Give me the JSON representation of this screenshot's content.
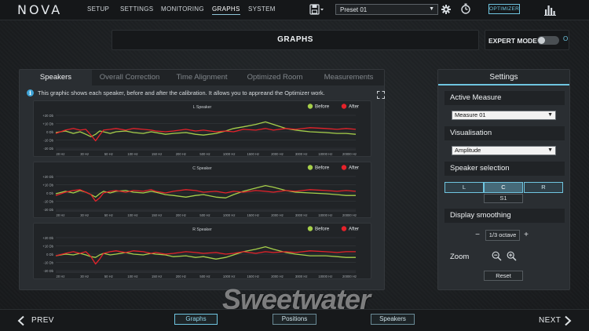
{
  "app": {
    "logo": "NOVA"
  },
  "nav": [
    {
      "label": "SETUP"
    },
    {
      "label": "SETTINGS"
    },
    {
      "label": "MONITORING"
    },
    {
      "label": "GRAPHS",
      "active": true
    },
    {
      "label": "SYSTEM"
    }
  ],
  "toolbar": {
    "save_icon": "save-icon",
    "preset": "Preset 01",
    "gear_icon": "gear-icon",
    "timer_icon": "stopwatch-icon",
    "optimizer_label": "OPTIMIZER",
    "bars_icon": "bar-graph-icon"
  },
  "header": {
    "title": "GRAPHS",
    "expert_label": "EXPERT MODE",
    "expert_on": false,
    "expert_state": "O"
  },
  "tabs": [
    {
      "label": "Speakers",
      "active": true
    },
    {
      "label": "Overall Correction"
    },
    {
      "label": "Time Alignment"
    },
    {
      "label": "Optimized Room"
    },
    {
      "label": "Measurements"
    }
  ],
  "info": {
    "icon": "i",
    "text": "This graphic shows each speaker, before and after the calibration. It allows you to appreand the Optimizer work."
  },
  "colors": {
    "before": "#a6cf4a",
    "after": "#e5222a",
    "accent": "#6fc5e0"
  },
  "chart_data": [
    {
      "type": "line",
      "title": "L Speaker",
      "legend": [
        "Before",
        "After"
      ],
      "legend_position": "top-right",
      "x_ticks": [
        "20 Hz",
        "30 Hz",
        "50 Hz",
        "100 Hz",
        "150 Hz",
        "200 Hz",
        "500 Hz",
        "1000 Hz",
        "1500 Hz",
        "2000 Hz",
        "3000 Hz",
        "10000 Hz",
        "20000 Hz"
      ],
      "y_ticks": [
        "+20 Db",
        "+10 Db",
        "0 Db",
        "-10 Db",
        "-20 Db"
      ],
      "ylim": [
        -20,
        20
      ],
      "x": [
        20,
        25,
        30,
        35,
        40,
        45,
        50,
        55,
        60,
        70,
        80,
        100,
        120,
        150,
        180,
        200,
        250,
        300,
        400,
        500,
        600,
        800,
        1000,
        1200,
        1500,
        2000,
        2500,
        3000,
        4000,
        5000,
        7000,
        10000,
        13000,
        16000,
        20000
      ],
      "series": [
        {
          "name": "Before",
          "values": [
            -1,
            1,
            -2,
            0,
            -3,
            -6,
            -3,
            1,
            0,
            -2,
            0,
            1,
            -1,
            -2,
            0,
            -1,
            -3,
            -2,
            -1,
            -3,
            -4,
            -2,
            1,
            4,
            6,
            9,
            12,
            9,
            4,
            2,
            0,
            -1,
            -2,
            -2,
            -3
          ]
        },
        {
          "name": "After",
          "values": [
            -2,
            2,
            4,
            2,
            3,
            -4,
            -11,
            -4,
            2,
            3,
            4,
            2,
            4,
            3,
            2,
            1,
            0,
            1,
            3,
            1,
            2,
            0,
            1,
            0,
            3,
            2,
            4,
            2,
            4,
            3,
            5,
            4,
            3,
            4,
            3
          ]
        }
      ]
    },
    {
      "type": "line",
      "title": "C Speaker",
      "legend": [
        "Before",
        "After"
      ],
      "legend_position": "top-right",
      "x_ticks": [
        "20 Hz",
        "30 Hz",
        "50 Hz",
        "100 Hz",
        "150 Hz",
        "200 Hz",
        "500 Hz",
        "1000 Hz",
        "1500 Hz",
        "2000 Hz",
        "3000 Hz",
        "10000 Hz",
        "20000 Hz"
      ],
      "y_ticks": [
        "+20 Db",
        "+10 Db",
        "0 Db",
        "-10 Db",
        "-20 Db"
      ],
      "ylim": [
        -20,
        20
      ],
      "x": [
        20,
        25,
        30,
        35,
        40,
        45,
        50,
        55,
        60,
        70,
        80,
        100,
        120,
        150,
        180,
        200,
        250,
        300,
        400,
        500,
        600,
        800,
        1000,
        1200,
        1500,
        2000,
        2500,
        3000,
        4000,
        5000,
        7000,
        10000,
        13000,
        16000,
        20000
      ],
      "series": [
        {
          "name": "Before",
          "values": [
            -1,
            2,
            0,
            3,
            1,
            -2,
            -5,
            -1,
            2,
            0,
            2,
            3,
            1,
            0,
            2,
            1,
            -2,
            -3,
            -5,
            -3,
            -2,
            -5,
            -6,
            -2,
            2,
            6,
            9,
            7,
            3,
            1,
            0,
            -1,
            -2,
            -3,
            -3
          ]
        },
        {
          "name": "After",
          "values": [
            -3,
            1,
            3,
            4,
            1,
            -2,
            -10,
            -6,
            0,
            2,
            3,
            1,
            3,
            2,
            4,
            2,
            0,
            2,
            4,
            3,
            1,
            2,
            0,
            2,
            1,
            3,
            2,
            1,
            3,
            2,
            4,
            3,
            2,
            3,
            2
          ]
        }
      ]
    },
    {
      "type": "line",
      "title": "R Speaker",
      "legend": [
        "Before",
        "After"
      ],
      "legend_position": "top-right",
      "x_ticks": [
        "20 Hz",
        "30 Hz",
        "50 Hz",
        "100 Hz",
        "150 Hz",
        "200 Hz",
        "500 Hz",
        "1000 Hz",
        "1500 Hz",
        "2000 Hz",
        "3000 Hz",
        "10000 Hz",
        "20000 Hz"
      ],
      "y_ticks": [
        "+20 Db",
        "+10 Db",
        "0 Db",
        "-10 Db",
        "-20 Db"
      ],
      "ylim": [
        -20,
        20
      ],
      "x": [
        20,
        25,
        30,
        35,
        40,
        45,
        50,
        55,
        60,
        70,
        80,
        100,
        120,
        150,
        180,
        200,
        250,
        300,
        400,
        500,
        600,
        800,
        1000,
        1200,
        1500,
        2000,
        2500,
        3000,
        4000,
        5000,
        7000,
        10000,
        13000,
        16000,
        20000
      ],
      "series": [
        {
          "name": "Before",
          "values": [
            -2,
            0,
            -1,
            1,
            -1,
            -3,
            -4,
            -1,
            1,
            -1,
            0,
            2,
            0,
            -1,
            1,
            0,
            -1,
            -3,
            -2,
            -4,
            -3,
            -6,
            -4,
            -1,
            3,
            6,
            9,
            6,
            2,
            0,
            -2,
            -2,
            -3,
            -4,
            -4
          ]
        },
        {
          "name": "After",
          "values": [
            -2,
            1,
            3,
            1,
            3,
            -3,
            -12,
            -6,
            1,
            3,
            4,
            2,
            4,
            3,
            1,
            2,
            0,
            1,
            3,
            2,
            1,
            2,
            0,
            1,
            3,
            1,
            3,
            2,
            3,
            2,
            4,
            3,
            2,
            3,
            3
          ]
        }
      ]
    }
  ],
  "settings": {
    "title": "Settings",
    "active_measure_label": "Active Measure",
    "active_measure_value": "Measure 01",
    "visualisation_label": "Visualisation",
    "visualisation_value": "Amplitude",
    "speaker_selection_label": "Speaker selection",
    "speakers": [
      "L",
      "C",
      "R"
    ],
    "speaker_selected": "C",
    "sub_label": "S1",
    "display_smoothing_label": "Display smoothing",
    "smoothing_value": "1/3 octave",
    "minus": "−",
    "plus": "+",
    "zoom_label": "Zoom",
    "reset_label": "Reset"
  },
  "bottom": {
    "prev_label": "PREV",
    "next_label": "NEXT",
    "tabs": [
      {
        "label": "Graphs",
        "active": true
      },
      {
        "label": "Positions"
      },
      {
        "label": "Speakers"
      }
    ],
    "watermark": "Sweetwater"
  }
}
